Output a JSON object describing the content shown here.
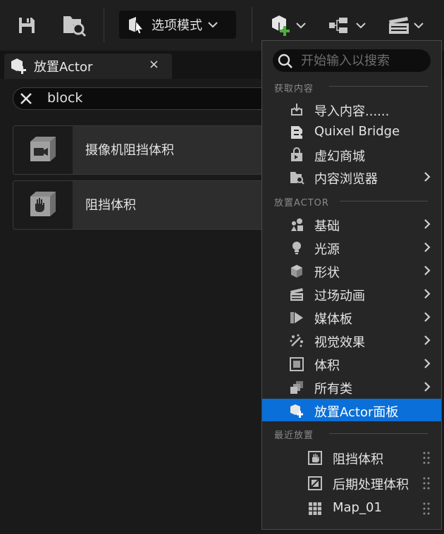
{
  "toolbar": {
    "mode_label": "选项模式"
  },
  "tab": {
    "title": "放置Actor",
    "close_glyph": "×"
  },
  "search": {
    "value": "block"
  },
  "results": [
    {
      "label": "摄像机阻挡体积",
      "icon": "camera-blocking-volume-icon"
    },
    {
      "label": "阻挡体积",
      "icon": "blocking-volume-icon"
    }
  ],
  "menu": {
    "search_placeholder": "开始输入以搜索",
    "section_content": "获取内容",
    "content_items": [
      {
        "label": "导入内容......",
        "icon": "import-icon",
        "submenu": false
      },
      {
        "label": "Quixel Bridge",
        "icon": "quixel-bridge-icon",
        "submenu": false
      },
      {
        "label": "虚幻商城",
        "icon": "marketplace-icon",
        "submenu": false
      },
      {
        "label": "内容浏览器",
        "icon": "content-browser-icon",
        "submenu": true
      }
    ],
    "section_place": "放置ACTOR",
    "place_items": [
      {
        "label": "基础",
        "icon": "basic-shapes-icon",
        "submenu": true
      },
      {
        "label": "光源",
        "icon": "light-bulb-icon",
        "submenu": true
      },
      {
        "label": "形状",
        "icon": "cube-shape-icon",
        "submenu": true
      },
      {
        "label": "过场动画",
        "icon": "clapperboard-icon",
        "submenu": true
      },
      {
        "label": "媒体板",
        "icon": "media-plate-icon",
        "submenu": true
      },
      {
        "label": "视觉效果",
        "icon": "visual-effects-icon",
        "submenu": true
      },
      {
        "label": "体积",
        "icon": "volume-icon",
        "submenu": true
      },
      {
        "label": "所有类",
        "icon": "all-classes-icon",
        "submenu": true
      },
      {
        "label": "放置Actor面板",
        "icon": "place-actors-panel-icon",
        "submenu": false,
        "active": true
      }
    ],
    "section_recent": "最近放置",
    "recent_items": [
      {
        "label": "阻挡体积",
        "icon": "blocking-volume-icon"
      },
      {
        "label": "后期处理体积",
        "icon": "post-process-volume-icon"
      },
      {
        "label": "Map_01",
        "icon": "map-grid-icon"
      }
    ]
  },
  "colors": {
    "accent": "#0a6fd8",
    "add_green": "#4caf3a"
  }
}
